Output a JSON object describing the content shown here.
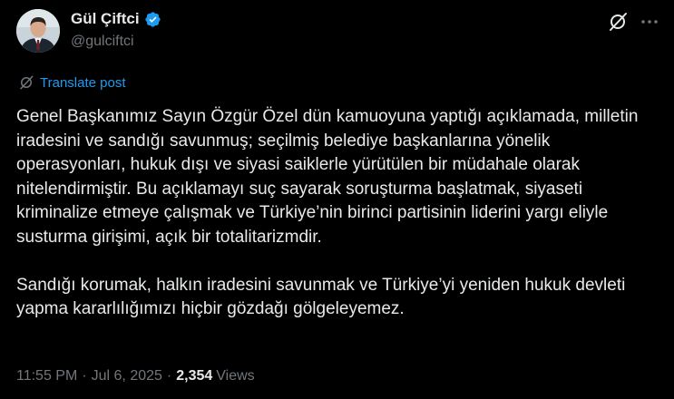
{
  "author": {
    "display_name": "Gül Çiftci",
    "handle": "@gulciftci",
    "verified": true,
    "verified_color": "#1d9bf0"
  },
  "header_actions": {
    "grok_icon": "grok-icon",
    "more_icon": "more-icon"
  },
  "translate": {
    "label": "Translate post",
    "color": "#1d9bf0"
  },
  "post": {
    "paragraphs": [
      "Genel Başkanımız Sayın Özgür Özel dün kamuoyuna yaptığı açıklamada, milletin iradesini ve sandığı savunmuş; seçilmiş belediye başkanlarına yönelik operasyonları, hukuk dışı ve siyasi saiklerle yürütülen bir müdahale olarak nitelendirmiştir. Bu açıklamayı suç sayarak soruşturma başlatmak, siyaseti kriminalize etmeye çalışmak ve Türkiye’nin birinci partisinin liderini yargı eliyle susturma girişimi, açık bir totalitarizmdir.",
      "Sandığı korumak, halkın iradesini savunmak ve Türkiye’yi yeniden hukuk devleti yapma kararlılığımızı hiçbir gözdağı gölgeleyemez."
    ]
  },
  "meta": {
    "time": "11:55 PM",
    "separator": "·",
    "date": "Jul 6, 2025",
    "views_count": "2,354",
    "views_label": "Views"
  }
}
